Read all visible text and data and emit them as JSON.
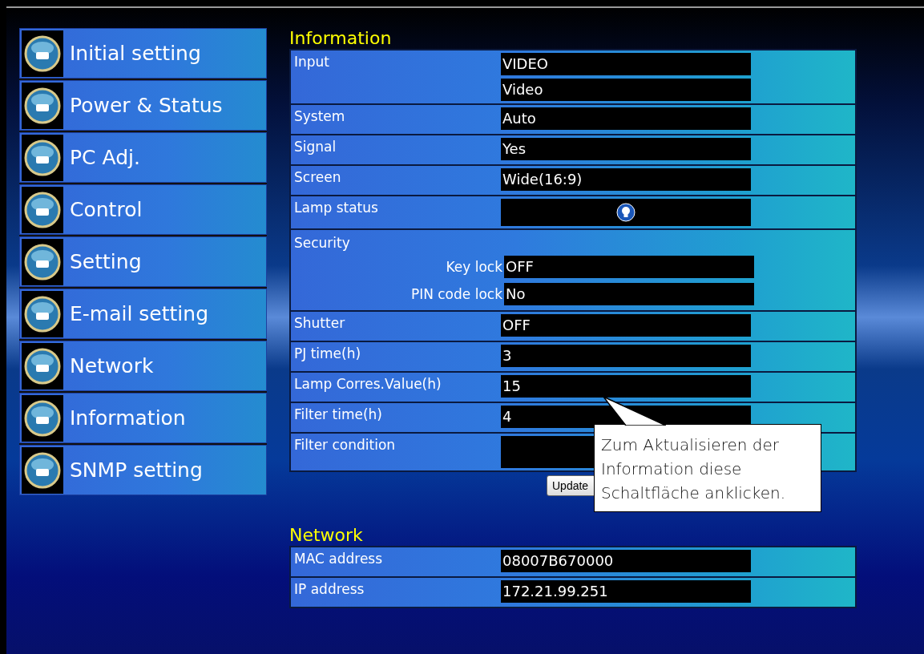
{
  "nav": [
    {
      "label": "Initial setting"
    },
    {
      "label": "Power & Status"
    },
    {
      "label": "PC Adj."
    },
    {
      "label": "Control"
    },
    {
      "label": "Setting"
    },
    {
      "label": "E-mail setting"
    },
    {
      "label": "Network"
    },
    {
      "label": "Information"
    },
    {
      "label": "SNMP setting"
    }
  ],
  "information": {
    "title": "Information",
    "rows": [
      {
        "kind": "values",
        "label": "Input",
        "values": [
          "VIDEO",
          "Video"
        ]
      },
      {
        "kind": "values",
        "label": "System",
        "values": [
          "Auto"
        ]
      },
      {
        "kind": "values",
        "label": "Signal",
        "values": [
          "Yes"
        ]
      },
      {
        "kind": "values",
        "label": "Screen",
        "values": [
          "Wide(16:9)"
        ]
      },
      {
        "kind": "lamp",
        "label": "Lamp status"
      },
      {
        "kind": "group",
        "label": "Security",
        "items": [
          {
            "label": "Key lock",
            "value": "OFF"
          },
          {
            "label": "PIN code lock",
            "value": "No"
          }
        ]
      },
      {
        "kind": "values",
        "label": "Shutter",
        "values": [
          "OFF"
        ]
      },
      {
        "kind": "values",
        "label": "PJ time(h)",
        "values": [
          "3"
        ]
      },
      {
        "kind": "values",
        "label": "Lamp Corres.Value(h)",
        "values": [
          "15"
        ]
      },
      {
        "kind": "values",
        "label": "Filter time(h)",
        "values": [
          "4"
        ]
      },
      {
        "kind": "blank",
        "label": "Filter condition"
      }
    ]
  },
  "update_button": "Update",
  "callout": "Zum Aktualisieren der Information diese Schaltfläche anklicken.",
  "network": {
    "title": "Network",
    "rows": [
      {
        "kind": "values",
        "label": "MAC address",
        "values": [
          "08007B670000"
        ]
      },
      {
        "kind": "values",
        "label": "IP address",
        "values": [
          "172.21.99.251"
        ]
      }
    ]
  }
}
